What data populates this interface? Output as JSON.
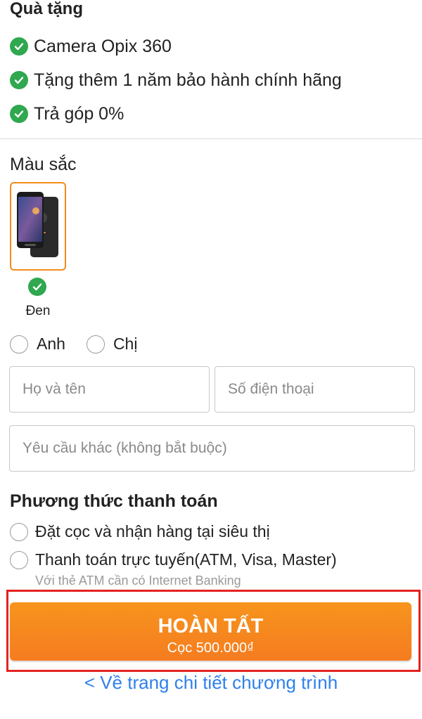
{
  "gifts": {
    "title": "Quà tặng",
    "items": [
      {
        "label": "Camera Opix 360",
        "icon": "check-circle-icon"
      },
      {
        "label": "Tặng thêm 1 năm bảo hành chính hãng",
        "icon": "check-circle-icon"
      },
      {
        "label": "Trả góp 0%",
        "icon": "check-circle-icon"
      }
    ]
  },
  "color": {
    "title": "Màu sắc",
    "selected_label": "Đen",
    "selected_icon": "check-circle-icon"
  },
  "gender": {
    "options": [
      "Anh",
      "Chị"
    ]
  },
  "form": {
    "name_placeholder": "Họ và tên",
    "phone_placeholder": "Số điện thoại",
    "note_placeholder": "Yêu cầu khác (không bắt buộc)"
  },
  "payment": {
    "title": "Phương thức thanh toán",
    "options": [
      {
        "label": "Đặt cọc và nhận hàng tại siêu thị"
      },
      {
        "label": "Thanh toán trực tuyến(ATM, Visa, Master)",
        "sub": "Với thẻ ATM cần có Internet Banking"
      }
    ]
  },
  "cta": {
    "main": "HOÀN TẤT",
    "sub": "Cọc 500.000₫"
  },
  "back_link": "< Về trang chi tiết chương trình",
  "colors": {
    "accent": "#f7941d",
    "check": "#2fa84f",
    "link": "#2f80ed",
    "highlight": "#e32221"
  }
}
